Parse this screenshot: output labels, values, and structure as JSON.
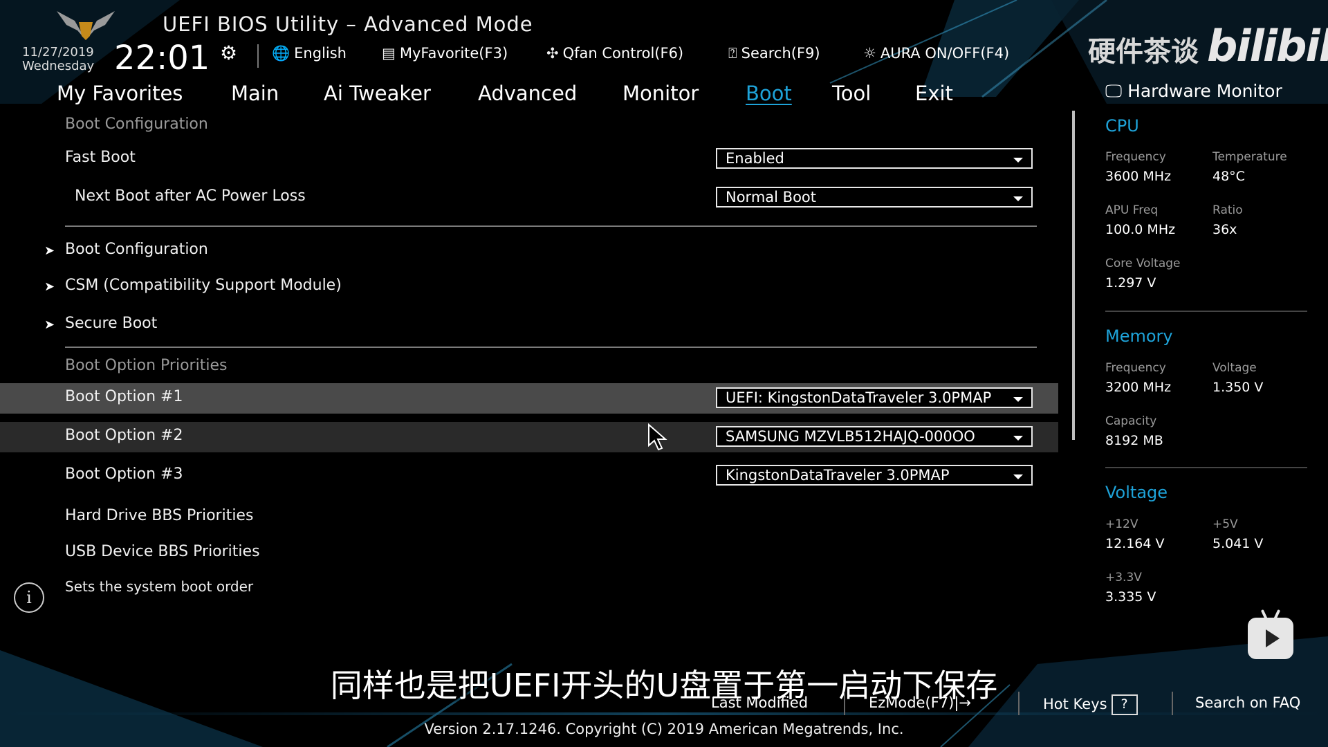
{
  "header": {
    "title": "UEFI BIOS Utility – Advanced Mode",
    "date": "11/27/2019",
    "weekday": "Wednesday",
    "time": "22:01",
    "tools": {
      "language": "English",
      "myfavorite": "MyFavorite(F3)",
      "qfan": "Qfan Control(F6)",
      "search": "Search(F9)",
      "aura": "AURA ON/OFF(F4)"
    },
    "watermark": "硬件茶谈",
    "watermark_logo": "bilibili"
  },
  "menu": {
    "items": [
      "My Favorites",
      "Main",
      "Ai Tweaker",
      "Advanced",
      "Monitor",
      "Boot",
      "Tool",
      "Exit"
    ],
    "active": "Boot",
    "hardware_monitor": "Hardware Monitor"
  },
  "main": {
    "section1": "Boot Configuration",
    "fast_boot": {
      "label": "Fast Boot",
      "value": "Enabled"
    },
    "next_boot": {
      "label": "Next Boot after AC Power Loss",
      "value": "Normal Boot"
    },
    "submenus": [
      "Boot Configuration",
      "CSM (Compatibility Support Module)",
      "Secure Boot"
    ],
    "section2": "Boot Option Priorities",
    "boot_options": [
      {
        "label": "Boot Option #1",
        "value": "UEFI: KingstonDataTraveler 3.0PMAP"
      },
      {
        "label": "Boot Option #2",
        "value": "SAMSUNG MZVLB512HAJQ-000OO"
      },
      {
        "label": "Boot Option #3",
        "value": "KingstonDataTraveler 3.0PMAP"
      }
    ],
    "hdd_bbs": "Hard Drive BBS Priorities",
    "usb_bbs": "USB Device BBS Priorities",
    "help_text": "Sets the system boot order"
  },
  "hardware_monitor": {
    "cpu": {
      "title": "CPU",
      "frequency_label": "Frequency",
      "frequency": "3600 MHz",
      "temperature_label": "Temperature",
      "temperature": "48°C",
      "apu_label": "APU Freq",
      "apu": "100.0 MHz",
      "ratio_label": "Ratio",
      "ratio": "36x",
      "core_voltage_label": "Core Voltage",
      "core_voltage": "1.297 V"
    },
    "memory": {
      "title": "Memory",
      "frequency_label": "Frequency",
      "frequency": "3200 MHz",
      "voltage_label": "Voltage",
      "voltage": "1.350 V",
      "capacity_label": "Capacity",
      "capacity": "8192 MB"
    },
    "voltage": {
      "title": "Voltage",
      "v12_label": "+12V",
      "v12": "12.164 V",
      "v5_label": "+5V",
      "v5": "5.041 V",
      "v33_label": "+3.3V",
      "v33": "3.335 V"
    }
  },
  "subtitle": "同样也是把UEFI开头的U盘置于第一启动下保存",
  "footer": {
    "last_modified": "Last Modified",
    "ezmode": "EzMode(F7)|→",
    "hotkeys": "Hot Keys",
    "hotkeys_icon": "?",
    "faq": "Search on FAQ",
    "version": "Version 2.17.1246. Copyright (C) 2019 American Megatrends, Inc."
  },
  "colors": {
    "accent": "#1ea3d9",
    "selected_row": "#4a4a4a",
    "hover_row": "#2a2a2a"
  }
}
